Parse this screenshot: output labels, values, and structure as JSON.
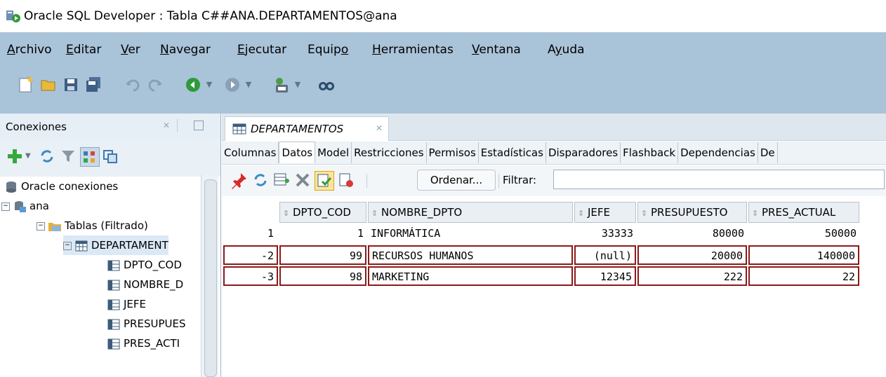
{
  "window": {
    "title": "Oracle SQL Developer : Tabla C##ANA.DEPARTAMENTOS@ana"
  },
  "menu": [
    {
      "pre": "",
      "u": "A",
      "post": "rchivo"
    },
    {
      "pre": "",
      "u": "E",
      "post": "ditar"
    },
    {
      "pre": "",
      "u": "V",
      "post": "er"
    },
    {
      "pre": "",
      "u": "N",
      "post": "avegar"
    },
    {
      "pre": "",
      "u": "E",
      "post": "jecutar"
    },
    {
      "pre": "Equip",
      "u": "o",
      "post": ""
    },
    {
      "pre": "",
      "u": "H",
      "post": "erramientas"
    },
    {
      "pre": "",
      "u": "V",
      "post": "entana"
    },
    {
      "pre": "A",
      "u": "y",
      "post": "uda"
    }
  ],
  "left_panel": {
    "title": "Conexiones",
    "tree": {
      "root": "Oracle conexiones",
      "connection": "ana",
      "tables_node": "Tablas (Filtrado)",
      "table": "DEPARTAMENT",
      "columns": [
        "DPTO_COD",
        "NOMBRE_D",
        "JEFE",
        "PRESUPUES",
        "PRES_ACTI"
      ]
    }
  },
  "editor": {
    "tab_label": "DEPARTAMENTOS",
    "subtabs": [
      "Columnas",
      "Datos",
      "Model",
      "Restricciones",
      "Permisos",
      "Estadísticas",
      "Disparadores",
      "Flashback",
      "Dependencias",
      "De"
    ],
    "active_subtab": "Datos",
    "ordenar_label": "Ordenar...",
    "filter_label": "Filtrar:",
    "filter_value": ""
  },
  "grid": {
    "headers": [
      "DPTO_COD",
      "NOMBRE_DPTO",
      "JEFE",
      "PRESUPUESTO",
      "PRES_ACTUAL"
    ],
    "rows": [
      {
        "n": "1",
        "dpto_cod": "1",
        "nombre": "INFORMÁTICA",
        "jefe": "33333",
        "presupuesto": "80000",
        "pres_actual": "50000",
        "edited": false
      },
      {
        "n": "-2",
        "dpto_cod": "99",
        "nombre": "RECURSOS HUMANOS",
        "jefe": "(null)",
        "presupuesto": "20000",
        "pres_actual": "140000",
        "edited": true
      },
      {
        "n": "-3",
        "dpto_cod": "98",
        "nombre": "MARKETING",
        "jefe": "12345",
        "presupuesto": "222",
        "pres_actual": "22",
        "edited": true
      }
    ]
  },
  "colors": {
    "band": "#a9c3d9",
    "edited_border": "#8b1a1a"
  }
}
